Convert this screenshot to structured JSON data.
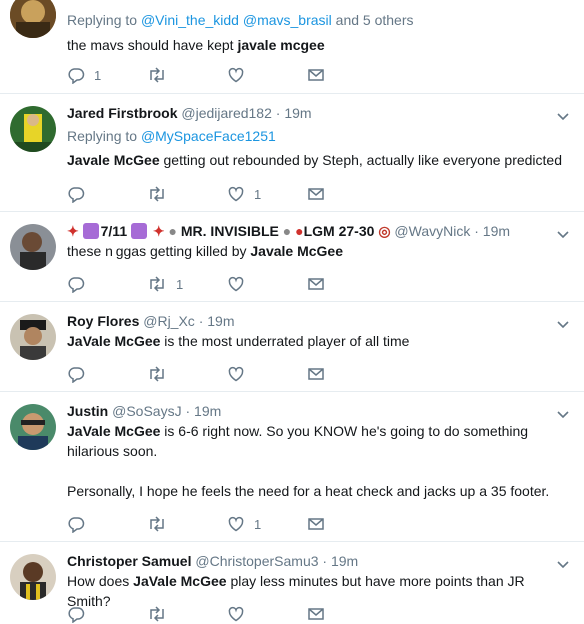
{
  "tweets": [
    {
      "reply_prefix": "Replying to",
      "reply_users": [
        "@Vini_the_kidd",
        "@mavs_brasil"
      ],
      "reply_suffix": "and 5 others",
      "text_plain": "the mavs should have kept",
      "text_bold": "javale mcgee",
      "reply_count": "1",
      "retweet_count": "",
      "like_count": ""
    },
    {
      "name": "Jared Firstbrook",
      "handle": "@jedijared182",
      "dot": "·",
      "time": "19m",
      "reply_prefix": "Replying to",
      "reply_users": [
        "@MySpaceFace1251"
      ],
      "text_bold": "Javale McGee",
      "text_plain": "getting out rebounded by Steph, actually like everyone predicted",
      "reply_count": "",
      "retweet_count": "",
      "like_count": "1"
    },
    {
      "name_segments": [
        "7/11",
        "MR. INVISIBLE",
        "LGM 27-30"
      ],
      "handle": "@WavyNick",
      "dot": "·",
      "time": "19m",
      "text_plain": "these n ggas getting killed by",
      "text_bold": "Javale McGee",
      "reply_count": "",
      "retweet_count": "1",
      "like_count": ""
    },
    {
      "name": "Roy Flores",
      "handle": "@Rj_Xc",
      "dot": "·",
      "time": "19m",
      "text_bold": "JaVale McGee",
      "text_plain": "is the most underrated player of all time",
      "reply_count": "",
      "retweet_count": "",
      "like_count": ""
    },
    {
      "name": "Justin",
      "handle": "@SoSaysJ",
      "dot": "·",
      "time": "19m",
      "text_bold": "JaVale McGee",
      "text_plain": "is 6-6 right now. So you KNOW he's going to do something hilarious soon.",
      "text_plain_2": "Personally, I hope he feels the need for a heat check and jacks up a 35 footer.",
      "reply_count": "",
      "retweet_count": "",
      "like_count": "1"
    },
    {
      "name": "Christoper Samuel",
      "handle": "@ChristoperSamu3",
      "dot": "·",
      "time": "19m",
      "text_pre": "How does",
      "text_bold": "JaVale McGee",
      "text_post": "play less minutes but have more points than JR Smith?"
    }
  ],
  "icons": {
    "reply": "reply-icon",
    "retweet": "retweet-icon",
    "like": "heart-icon",
    "dm": "envelope-icon",
    "more": "chevron-down-icon"
  },
  "colors": {
    "link": "#1b95e0",
    "muted": "#657786",
    "text": "#14171a",
    "divider": "#e6ecf0"
  }
}
